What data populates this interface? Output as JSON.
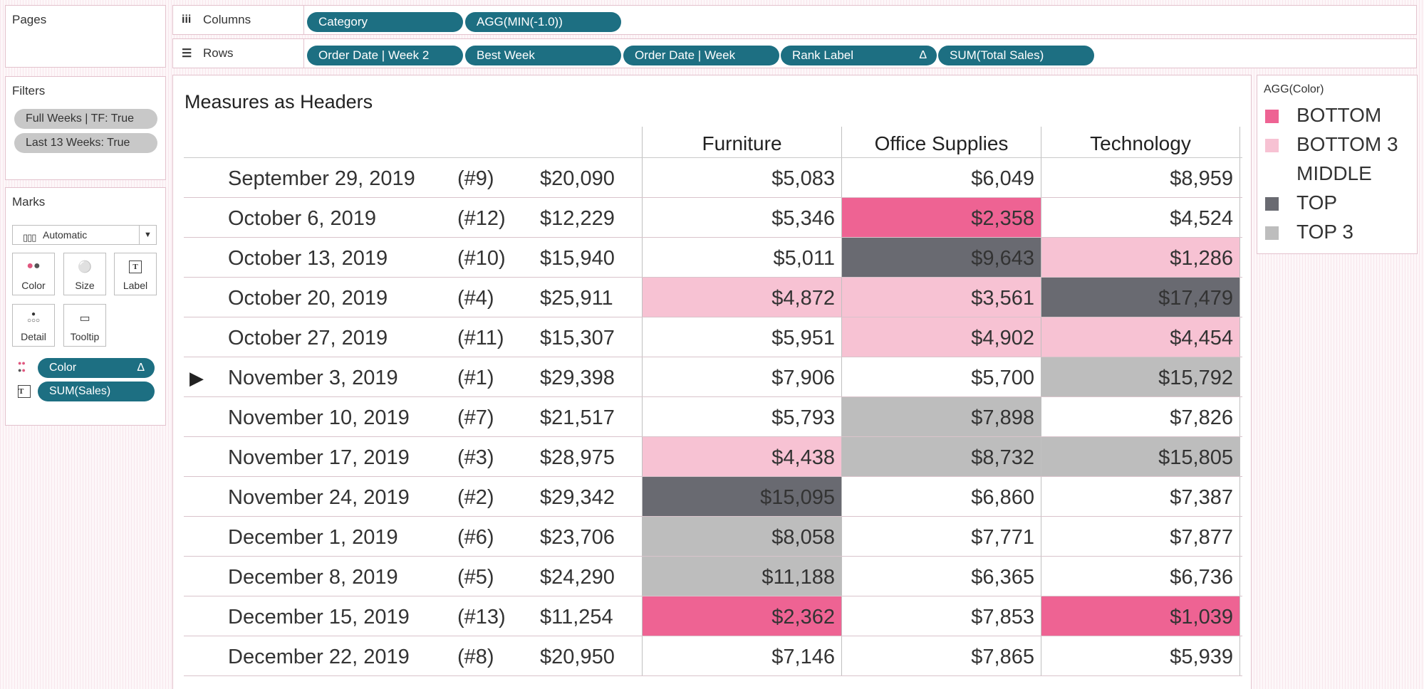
{
  "pages": {
    "title": "Pages"
  },
  "shelves": {
    "columns": {
      "label": "Columns",
      "pills": [
        "Category",
        "AGG(MIN(-1.0))"
      ]
    },
    "rows": {
      "label": "Rows",
      "pills": [
        "Order Date | Week 2",
        "Best Week",
        "Order Date | Week",
        "Rank Label",
        "SUM(Total Sales)"
      ]
    },
    "delta_glyph": "Δ"
  },
  "filters": {
    "title": "Filters",
    "items": [
      "Full Weeks | TF: True",
      "Last 13 Weeks: True"
    ]
  },
  "marks": {
    "title": "Marks",
    "type": "Automatic",
    "buttons": [
      "Color",
      "Size",
      "Label",
      "Detail",
      "Tooltip"
    ],
    "fields": [
      {
        "label": "Color",
        "icon": "color-dots-icon"
      },
      {
        "label": "SUM(Sales)",
        "icon": "text-icon"
      }
    ]
  },
  "view": {
    "title": "Measures as Headers",
    "headers": [
      "Furniture",
      "Office Supplies",
      "Technology"
    ],
    "rows": [
      {
        "date": "September 29, 2019",
        "rank": "(#9)",
        "total": "$20,090",
        "values": [
          "$5,083",
          "$6,049",
          "$8,959"
        ],
        "levels": [
          "MIDDLE",
          "MIDDLE",
          "MIDDLE"
        ]
      },
      {
        "date": "October 6, 2019",
        "rank": "(#12)",
        "total": "$12,229",
        "values": [
          "$5,346",
          "$2,358",
          "$4,524"
        ],
        "levels": [
          "MIDDLE",
          "BOTTOM",
          "MIDDLE"
        ]
      },
      {
        "date": "October 13, 2019",
        "rank": "(#10)",
        "total": "$15,940",
        "values": [
          "$5,011",
          "$9,643",
          "$1,286"
        ],
        "levels": [
          "MIDDLE",
          "TOP",
          "BOTTOM 3"
        ]
      },
      {
        "date": "October 20, 2019",
        "rank": "(#4)",
        "total": "$25,911",
        "values": [
          "$4,872",
          "$3,561",
          "$17,479"
        ],
        "levels": [
          "BOTTOM 3",
          "BOTTOM 3",
          "TOP"
        ]
      },
      {
        "date": "October 27, 2019",
        "rank": "(#11)",
        "total": "$15,307",
        "values": [
          "$5,951",
          "$4,902",
          "$4,454"
        ],
        "levels": [
          "MIDDLE",
          "BOTTOM 3",
          "BOTTOM 3"
        ]
      },
      {
        "date": "November 3, 2019",
        "rank": "(#1)",
        "total": "$29,398",
        "values": [
          "$7,906",
          "$5,700",
          "$15,792"
        ],
        "levels": [
          "MIDDLE",
          "MIDDLE",
          "TOP 3"
        ],
        "selected": true
      },
      {
        "date": "November 10, 2019",
        "rank": "(#7)",
        "total": "$21,517",
        "values": [
          "$5,793",
          "$7,898",
          "$7,826"
        ],
        "levels": [
          "MIDDLE",
          "TOP 3",
          "MIDDLE"
        ]
      },
      {
        "date": "November 17, 2019",
        "rank": "(#3)",
        "total": "$28,975",
        "values": [
          "$4,438",
          "$8,732",
          "$15,805"
        ],
        "levels": [
          "BOTTOM 3",
          "TOP 3",
          "TOP 3"
        ]
      },
      {
        "date": "November 24, 2019",
        "rank": "(#2)",
        "total": "$29,342",
        "values": [
          "$15,095",
          "$6,860",
          "$7,387"
        ],
        "levels": [
          "TOP",
          "MIDDLE",
          "MIDDLE"
        ]
      },
      {
        "date": "December 1, 2019",
        "rank": "(#6)",
        "total": "$23,706",
        "values": [
          "$8,058",
          "$7,771",
          "$7,877"
        ],
        "levels": [
          "TOP 3",
          "MIDDLE",
          "MIDDLE"
        ]
      },
      {
        "date": "December 8, 2019",
        "rank": "(#5)",
        "total": "$24,290",
        "values": [
          "$11,188",
          "$6,365",
          "$6,736"
        ],
        "levels": [
          "TOP 3",
          "MIDDLE",
          "MIDDLE"
        ]
      },
      {
        "date": "December 15, 2019",
        "rank": "(#13)",
        "total": "$11,254",
        "values": [
          "$2,362",
          "$7,853",
          "$1,039"
        ],
        "levels": [
          "BOTTOM",
          "MIDDLE",
          "BOTTOM"
        ]
      },
      {
        "date": "December 22, 2019",
        "rank": "(#8)",
        "total": "$20,950",
        "values": [
          "$7,146",
          "$7,865",
          "$5,939"
        ],
        "levels": [
          "MIDDLE",
          "MIDDLE",
          "MIDDLE"
        ]
      }
    ]
  },
  "legend": {
    "title": "AGG(Color)",
    "items": [
      {
        "label": "BOTTOM",
        "color": "#ee6393"
      },
      {
        "label": "BOTTOM 3",
        "color": "#f7c2d3"
      },
      {
        "label": "MIDDLE",
        "color": "#ffffff"
      },
      {
        "label": "TOP",
        "color": "#696a71"
      },
      {
        "label": "TOP 3",
        "color": "#bdbdbd"
      }
    ]
  },
  "colors": {
    "pill": "#1d6f82",
    "border": "#e3c2cd"
  }
}
